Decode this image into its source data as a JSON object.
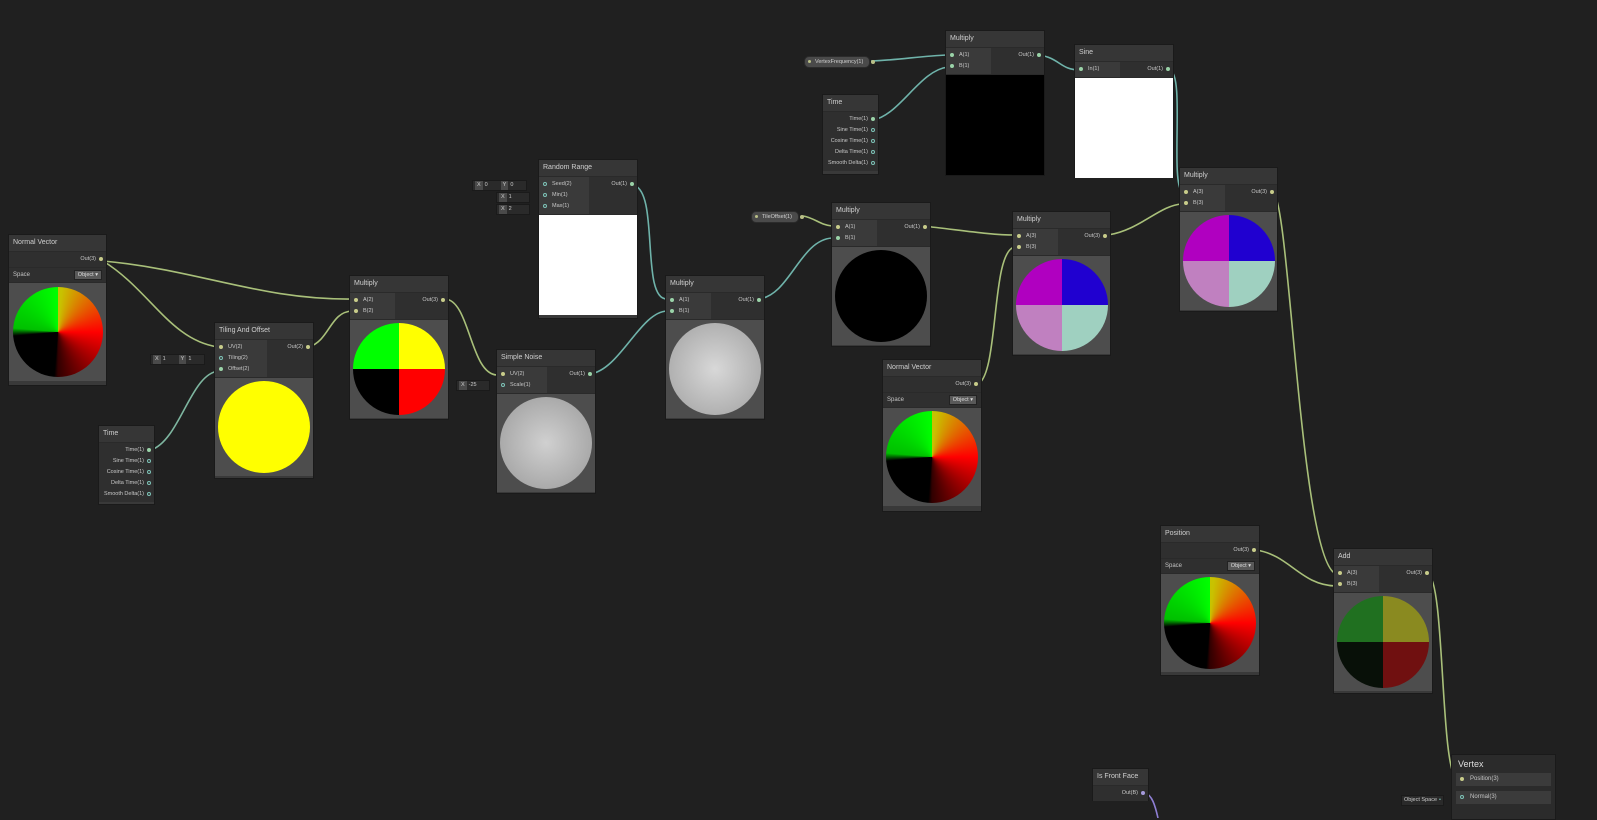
{
  "nodes": {
    "normal_vector_1": {
      "title": "Normal Vector",
      "out": "Out(3)",
      "space_label": "Space",
      "space_value": "Object"
    },
    "time_1": {
      "title": "Time",
      "outs": [
        "Time(1)",
        "Sine Time(1)",
        "Cosine Time(1)",
        "Delta Time(1)",
        "Smooth Delta(1)"
      ]
    },
    "tiling_offset": {
      "title": "Tiling And Offset",
      "ins": [
        "UV(2)",
        "Tiling(2)",
        "Offset(2)"
      ],
      "out": "Out(2)",
      "tiling_x": "1",
      "tiling_y": "1"
    },
    "multiply_1": {
      "title": "Multiply",
      "ins": [
        "A(2)",
        "B(2)"
      ],
      "out": "Out(3)"
    },
    "simple_noise": {
      "title": "Simple Noise",
      "ins": [
        "UV(2)",
        "Scale(1)"
      ],
      "out": "Out(1)",
      "scale_value": "-25"
    },
    "random_range": {
      "title": "Random Range",
      "ins": [
        "Seed(2)",
        "Min(1)",
        "Max(1)"
      ],
      "out": "Out(1)",
      "seed_x": "0",
      "seed_y": "0",
      "min": "1",
      "max": "2"
    },
    "multiply_2": {
      "title": "Multiply",
      "ins": [
        "A(1)",
        "B(1)"
      ],
      "out": "Out(1)"
    },
    "multiply_3": {
      "title": "Multiply",
      "ins": [
        "A(1)",
        "B(1)"
      ],
      "out": "Out(1)"
    },
    "time_2": {
      "title": "Time",
      "outs": [
        "Time(1)",
        "Sine Time(1)",
        "Cosine Time(1)",
        "Delta Time(1)",
        "Smooth Delta(1)"
      ]
    },
    "multiply_top": {
      "title": "Multiply",
      "ins": [
        "A(1)",
        "B(1)"
      ],
      "out": "Out(1)"
    },
    "sine": {
      "title": "Sine",
      "ins": [
        "In(1)"
      ],
      "out": "Out(1)"
    },
    "normal_vector_2": {
      "title": "Normal Vector",
      "out": "Out(3)",
      "space_label": "Space",
      "space_value": "Object"
    },
    "multiply_4": {
      "title": "Multiply",
      "ins": [
        "A(3)",
        "B(3)"
      ],
      "out": "Out(3)"
    },
    "multiply_5": {
      "title": "Multiply",
      "ins": [
        "A(3)",
        "B(3)"
      ],
      "out": "Out(3)"
    },
    "position": {
      "title": "Position",
      "out": "Out(3)",
      "space_label": "Space",
      "space_value": "Object"
    },
    "add": {
      "title": "Add",
      "ins": [
        "A(3)",
        "B(3)"
      ],
      "out": "Out(3)"
    },
    "is_front_face": {
      "title": "Is Front Face",
      "out": "Out(B)"
    },
    "vertex": {
      "title": "Vertex",
      "slots": [
        "Position(3)",
        "Normal(3)"
      ],
      "normal_space": "Object Space"
    }
  },
  "properties": {
    "vertex_frequency": "VertexFrequency(1)",
    "tile_offset": "TileOffset(1)"
  },
  "labels": {
    "x": "X",
    "y": "Y"
  },
  "colors": {
    "background": "#202020",
    "node": "#393939",
    "wire_vector": "#a9c07a",
    "wire_float": "#6fb3aa",
    "wire_bool": "#8f7fd4"
  }
}
